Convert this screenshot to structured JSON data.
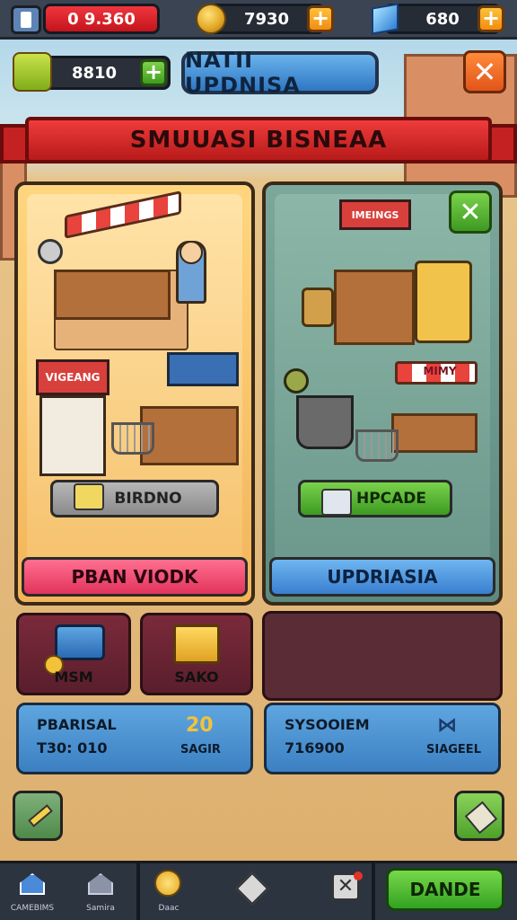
{
  "topbar": {
    "money": "0 9.360",
    "coins": "7930",
    "gems": "680"
  },
  "header": {
    "side_counter": "8810",
    "title": "NATII UPDNISA",
    "banner": "SMUUASI BISNEAA"
  },
  "left_card": {
    "stall_sign": "VIGEANG",
    "pill_label": "BIRDNO",
    "button_label": "PBAN VIODK"
  },
  "right_card": {
    "stall_sign": "IMEINGS",
    "awning_sign": "MIMY",
    "pill_label": "HPCADE",
    "button_label": "UPDRIASIA"
  },
  "items": [
    {
      "label": "MSM"
    },
    {
      "label": "SAKO"
    }
  ],
  "info_left": {
    "line1": "PBARISAL",
    "line2": "T30: 010",
    "value": "20",
    "sub": "SAGIR"
  },
  "info_right": {
    "line1": "SYSOOIEM",
    "line2": "716900",
    "sub": "SIAGEEL"
  },
  "nav": {
    "items": [
      {
        "label": "CAMEBIMS"
      },
      {
        "label": "Samira"
      },
      {
        "label": "Daac"
      }
    ],
    "done": "DANDE"
  }
}
